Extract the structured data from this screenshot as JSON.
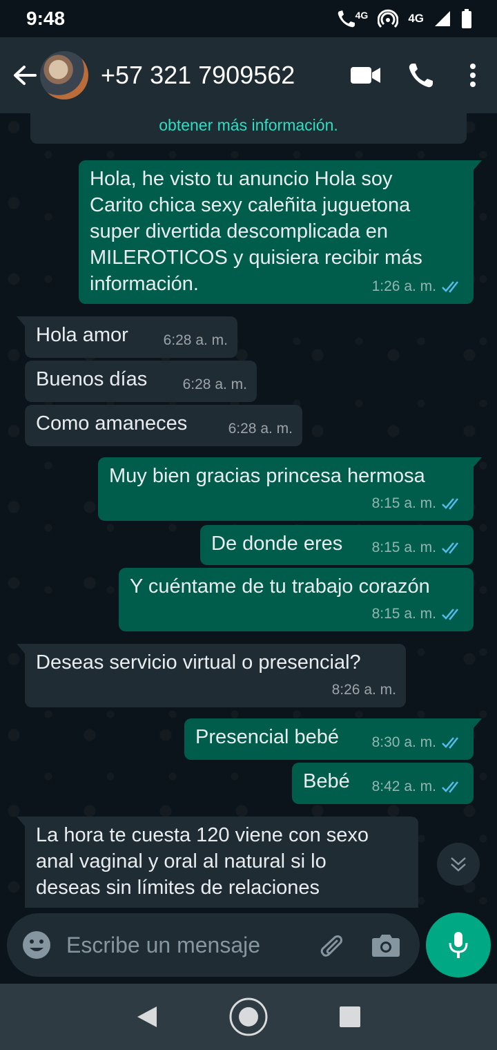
{
  "status_bar": {
    "time": "9:48",
    "call_network": "4G",
    "network": "4G"
  },
  "header": {
    "contact": "+57 321 7909562"
  },
  "system_message": "obtener más información.",
  "messages": [
    {
      "direction": "out",
      "text": "Hola, he visto tu anuncio Hola soy\nCarito chica sexy caleñita juguetona\nsuper divertida descomplicada en\nMILEROTICOS y quisiera recibir más\ninformación.",
      "time": "1:26 a. m.",
      "read": true
    },
    {
      "direction": "in",
      "text": "Hola amor",
      "time": "6:28 a. m."
    },
    {
      "direction": "in",
      "text": "Buenos días",
      "time": "6:28 a. m."
    },
    {
      "direction": "in",
      "text": "Como amaneces",
      "time": "6:28 a. m."
    },
    {
      "direction": "out",
      "text": "Muy bien gracias princesa hermosa",
      "time": "8:15 a. m.",
      "read": true
    },
    {
      "direction": "out",
      "text": "De donde eres",
      "time": "8:15 a. m.",
      "read": true
    },
    {
      "direction": "out",
      "text": "Y cuéntame de tu trabajo corazón",
      "time": "8:15 a. m.",
      "read": true
    },
    {
      "direction": "in",
      "text": "Deseas servicio virtual o presencial?",
      "time": "8:26 a. m."
    },
    {
      "direction": "out",
      "text": "Presencial bebé",
      "time": "8:30 a. m.",
      "read": true
    },
    {
      "direction": "out",
      "text": "Bebé",
      "time": "8:42 a. m.",
      "read": true
    },
    {
      "direction": "in",
      "text": "La hora te cuesta 120 viene con sexo\nanal vaginal y oral al natural si lo\ndeseas sin límites de relaciones",
      "time": ""
    }
  ],
  "input": {
    "placeholder": "Escribe un mensaje"
  },
  "colors": {
    "background": "#0b141a",
    "bar": "#1f2c33",
    "outgoing_bubble": "#005c4b",
    "incoming_bubble": "#1f2c33",
    "accent": "#00a884",
    "read_ticks": "#53bdeb"
  },
  "icons": {
    "back": "arrow-left-icon",
    "video": "video-camera-icon",
    "call": "phone-icon",
    "menu": "more-vertical-icon",
    "scroll": "double-chevron-down-icon",
    "emoji": "smiley-icon",
    "attach": "paperclip-icon",
    "camera": "camera-icon",
    "mic": "microphone-icon"
  }
}
